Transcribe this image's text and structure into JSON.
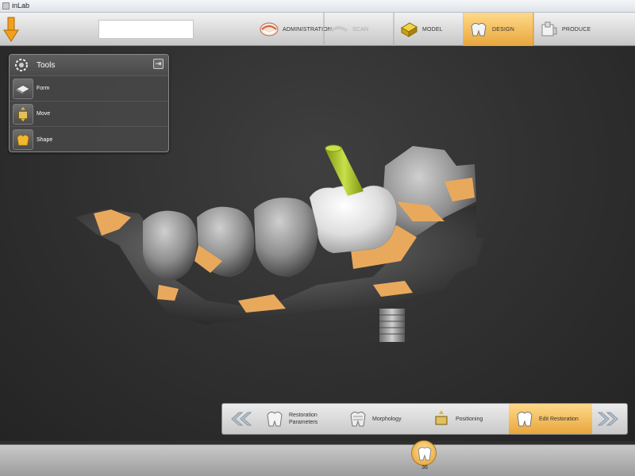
{
  "window": {
    "title": "inLab"
  },
  "toolbar": {
    "name_field_value": "",
    "phases": [
      {
        "label": "ADMINISTRATION",
        "icon": "dentures-icon",
        "state": "normal"
      },
      {
        "label": "SCAN",
        "icon": "scan-icon",
        "state": "disabled"
      },
      {
        "label": "MODEL",
        "icon": "model-icon",
        "state": "normal"
      },
      {
        "label": "DESIGN",
        "icon": "design-tooth-icon",
        "state": "active"
      },
      {
        "label": "PRODUCE",
        "icon": "mill-icon",
        "state": "normal"
      }
    ]
  },
  "tools_panel": {
    "title": "Tools",
    "items": [
      {
        "label": "Form",
        "icon": "form-icon"
      },
      {
        "label": "Move",
        "icon": "move-icon"
      },
      {
        "label": "Shape",
        "icon": "shape-icon"
      }
    ]
  },
  "step_bar": {
    "steps": [
      {
        "label": "Restoration Parameters",
        "icon": "tooth-parameters-icon",
        "state": "normal"
      },
      {
        "label": "Morphology",
        "icon": "morphology-icon",
        "state": "normal"
      },
      {
        "label": "Positioning",
        "icon": "positioning-icon",
        "state": "normal"
      },
      {
        "label": "Edit Restoration",
        "icon": "edit-restoration-icon",
        "state": "active"
      }
    ]
  },
  "tooth_selector": {
    "number": "36"
  },
  "colors": {
    "accent_orange": "#e8a63c",
    "accent_light": "#ffd98a",
    "background_dark": "#2f2f2f"
  }
}
